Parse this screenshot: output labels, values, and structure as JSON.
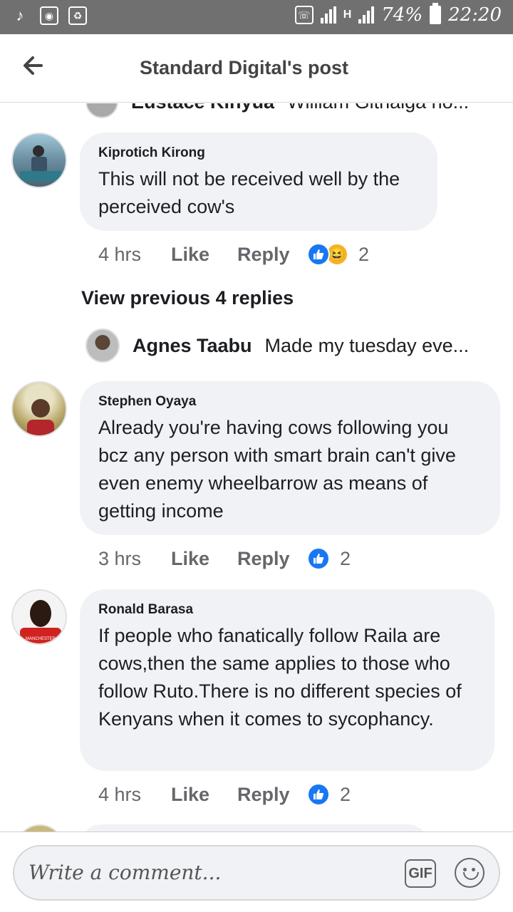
{
  "status_bar": {
    "battery": "74%",
    "time": "22:20",
    "network": "H",
    "left_icons": [
      "music-note-icon",
      "camera-icon",
      "recycle-icon"
    ]
  },
  "app_bar": {
    "title": "Standard Digital's post"
  },
  "clipped_comment": {
    "author": "Eustace Kinyua",
    "preview": "William Githaiga no..."
  },
  "comments": [
    {
      "author": "Kiprotich Kirong",
      "text": "This will not be received well by the perceived cow's",
      "time": "4 hrs",
      "like_label": "Like",
      "reply_label": "Reply",
      "reactions": [
        "like",
        "haha"
      ],
      "reaction_count": "2"
    },
    {
      "author": "Stephen Oyaya",
      "text": "Already you're having cows following you bcz any person with smart brain can't give even enemy wheelbarrow as means of getting income",
      "time": "3 hrs",
      "like_label": "Like",
      "reply_label": "Reply",
      "reactions": [
        "like"
      ],
      "reaction_count": "2"
    },
    {
      "author": "Ronald Barasa",
      "text": "If people who fanatically follow Raila are cows,then the same applies to those who follow Ruto.There is no different species of Kenyans when it comes to sycophancy.",
      "time": "4 hrs",
      "like_label": "Like",
      "reply_label": "Reply",
      "reactions": [
        "like"
      ],
      "reaction_count": "2"
    }
  ],
  "replies_thread": {
    "view_previous": "View previous 4 replies",
    "reply_author": "Agnes Taabu",
    "reply_preview": "Made my tuesday eve..."
  },
  "composer": {
    "placeholder": "Write a comment...",
    "gif_label": "GIF"
  },
  "colors": {
    "status_bar": "#707070",
    "bubble": "#f0f2f5",
    "like_blue": "#1877f2",
    "haha_yellow": "#f7b125",
    "meta_gray": "#65676b"
  }
}
